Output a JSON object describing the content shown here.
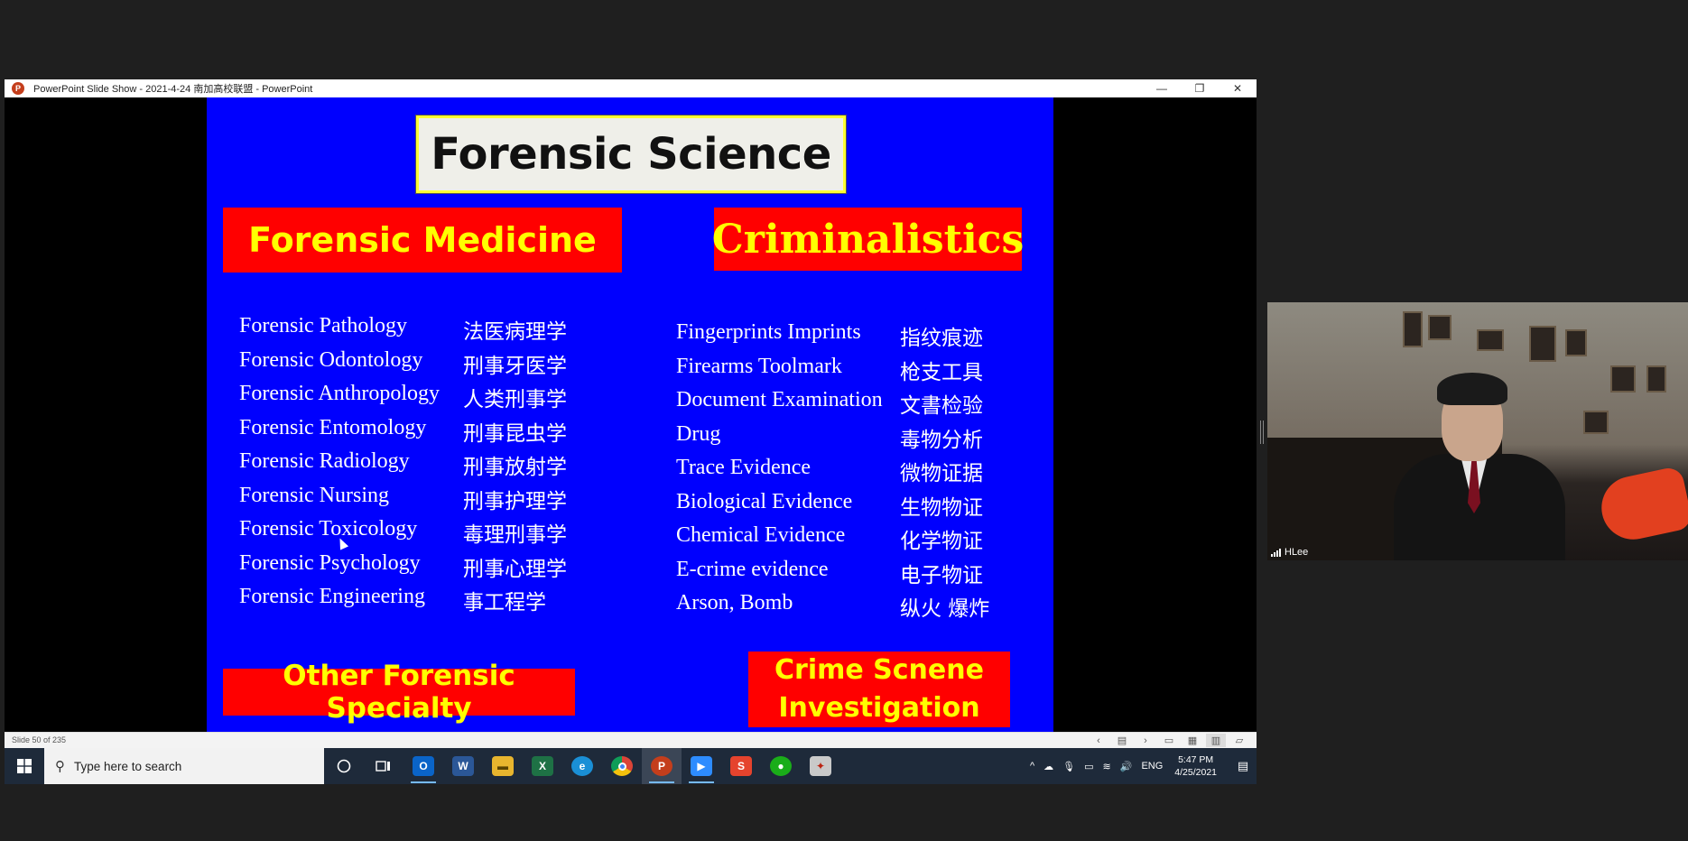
{
  "window": {
    "title": "PowerPoint Slide Show  -  2021-4-24 南加高校联盟 - PowerPoint",
    "minimize": "—",
    "restore": "❐",
    "close": "✕"
  },
  "slide": {
    "title": "Forensic Science",
    "left_heading": "Forensic Medicine",
    "right_heading": "Criminalistics",
    "left_items": [
      {
        "en": "Forensic Pathology",
        "zh": "法医病理学"
      },
      {
        "en": "Forensic Odontology",
        "zh": "刑事牙医学"
      },
      {
        "en": "Forensic Anthropology",
        "zh": "人类刑事学"
      },
      {
        "en": "Forensic Entomology",
        "zh": "刑事昆虫学"
      },
      {
        "en": "Forensic Radiology",
        "zh": "刑事放射学"
      },
      {
        "en": "Forensic Nursing",
        "zh": "刑事护理学"
      },
      {
        "en": "Forensic Toxicology",
        "zh": "毒理刑事学"
      },
      {
        "en": "Forensic Psychology",
        "zh": "刑事心理学"
      },
      {
        "en": "Forensic Engineering",
        "zh": "事工程学"
      }
    ],
    "right_items": [
      {
        "en": "Fingerprints Imprints",
        "zh": "指纹痕迹"
      },
      {
        "en": "Firearms Toolmark",
        "zh": "枪支工具"
      },
      {
        "en": "Document Examination",
        "zh": "文書检验"
      },
      {
        "en": "Drug",
        "zh": "毒物分析"
      },
      {
        "en": "Trace Evidence",
        "zh": "微物证据"
      },
      {
        "en": "Biological Evidence",
        "zh": "生物物证"
      },
      {
        "en": "Chemical Evidence",
        "zh": "化学物证"
      },
      {
        "en": "E-crime evidence",
        "zh": "电子物证"
      },
      {
        "en": "Arson, Bomb",
        "zh": "纵火 爆炸"
      }
    ],
    "bottom_left": "Other Forensic Specialty",
    "bottom_right": "Crime Scnene\nInvestigation"
  },
  "statusbar": {
    "slide_count": "Slide 50 of 235"
  },
  "taskbar": {
    "search_placeholder": "Type here to search",
    "language": "ENG",
    "time": "5:47 PM",
    "date": "4/25/2021"
  },
  "video": {
    "participant": "HLee"
  },
  "colors": {
    "slide_bg": "#0000fe",
    "banner_red": "#ff0000",
    "banner_text": "#ffff00"
  }
}
